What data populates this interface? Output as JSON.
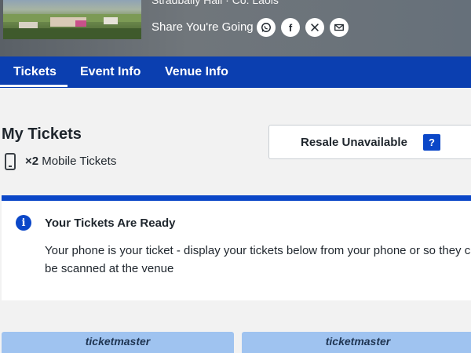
{
  "header": {
    "venue_line": "Stradbally Hall · Co. Laois",
    "share_label": "Share You're Going",
    "share_buttons": [
      {
        "icon": "whatsapp-icon",
        "glyph": "✆"
      },
      {
        "icon": "facebook-icon",
        "glyph": "f"
      },
      {
        "icon": "x-icon",
        "glyph": "𝕏"
      },
      {
        "icon": "email-icon",
        "glyph": "✉"
      }
    ]
  },
  "tabs": [
    {
      "label": "Tickets",
      "active": true
    },
    {
      "label": "Event Info",
      "active": false
    },
    {
      "label": "Venue Info",
      "active": false
    }
  ],
  "my_tickets": {
    "title": "My Tickets",
    "count": "×2",
    "type": "Mobile Tickets"
  },
  "resale": {
    "label": "Resale Unavailable",
    "help": "?"
  },
  "notice": {
    "info_glyph": "i",
    "title": "Your Tickets Are Ready",
    "body": "Your phone is your ticket - display your tickets below from your phone or so they can be scanned at the venue"
  },
  "ticket_cards": [
    {
      "brand": "ticketmaster"
    },
    {
      "brand": "ticketmaster"
    }
  ],
  "colors": {
    "brand_blue": "#0b3fb0",
    "accent_blue": "#0b47c8",
    "ticket_blue": "#9fc3f0"
  }
}
